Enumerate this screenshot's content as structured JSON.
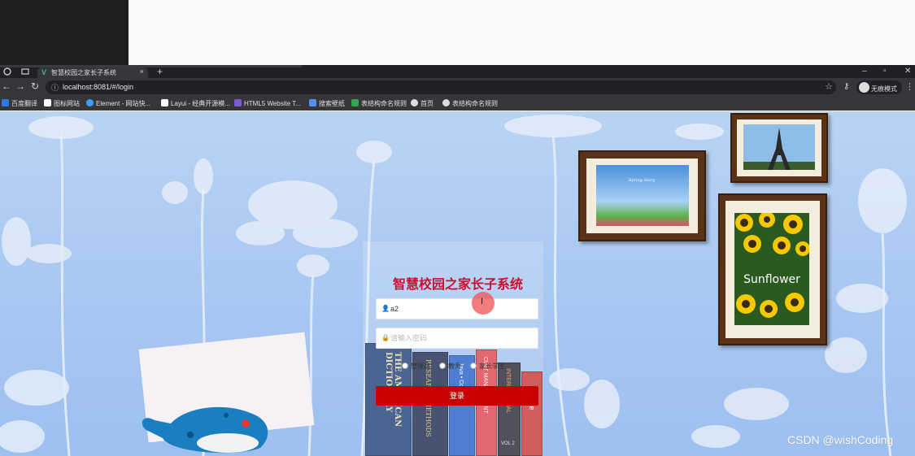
{
  "browser": {
    "tab_title": "智慧校园之家长子系统",
    "url": "localhost:8081/#/login",
    "incognito_label": "无痕模式"
  },
  "bookmarks": [
    {
      "label": "百度翻译",
      "color": "#2b7be4"
    },
    {
      "label": "图标网站",
      "color": "#ffffff"
    },
    {
      "label": "Element - 网站快...",
      "color": "#409eff"
    },
    {
      "label": "Layui - 经典开源模...",
      "color": "#ffffff"
    },
    {
      "label": "HTML5 Website T...",
      "color": "#7b5cd6"
    },
    {
      "label": "搜索壁纸",
      "color": "#5b8def"
    },
    {
      "label": "表结构命名规则",
      "color": "#2fa84f"
    },
    {
      "label": "首页",
      "color": "#dddddd"
    },
    {
      "label": "表结构命名规则",
      "color": "#dddddd"
    }
  ],
  "login": {
    "title": "智慧校园之家长子系统",
    "username_value": "a2",
    "password_placeholder": "请输入密码",
    "roles": [
      "管理员",
      "教师",
      "家长学生"
    ],
    "submit_label": "登录"
  },
  "decor": {
    "frame1_caption": "Spring Story",
    "frame3_caption": "Sunflower",
    "book_spines": [
      "THE AMERICAN DICTIONARY",
      "RESEARCH METHODS",
      "Java • Cookbook",
      "CULT MANAGEMENT",
      "INTERNATIONAL",
      "VOL 2",
      "Che"
    ]
  },
  "watermark": "CSDN @wishCoding"
}
